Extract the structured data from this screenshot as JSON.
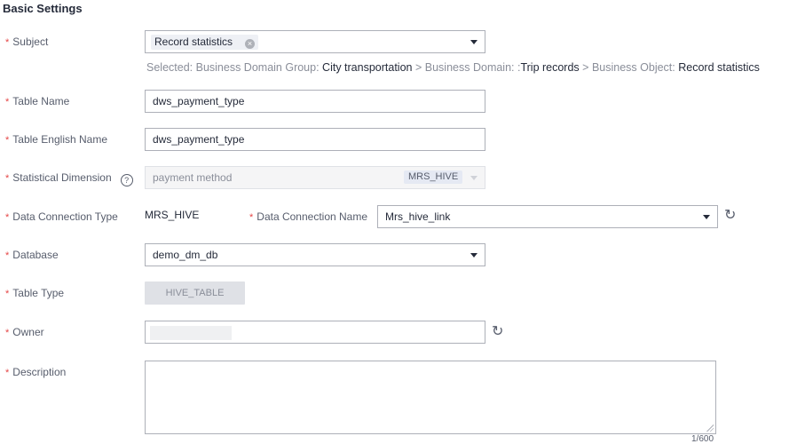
{
  "section_title": "Basic Settings",
  "required_mark": "*",
  "subject": {
    "label": "Subject",
    "tag": "Record statistics",
    "tag_remove_glyph": "×"
  },
  "selected_path": {
    "prefix": "Selected:",
    "group_label": "Business Domain Group:",
    "group_value": "City transportation",
    "separator": ">",
    "domain_label": "Business Domain: :",
    "domain_value": "Trip records",
    "object_label": "Business Object:",
    "object_value": "Record statistics"
  },
  "table_name": {
    "label": "Table Name",
    "value": "dws_payment_type"
  },
  "table_english_name": {
    "label": "Table English Name",
    "value": "dws_payment_type"
  },
  "statistical_dimension": {
    "label": "Statistical Dimension",
    "help_glyph": "?",
    "value": "payment method",
    "chip": "MRS_HIVE"
  },
  "data_connection_type": {
    "label": "Data Connection Type",
    "value": "MRS_HIVE"
  },
  "data_connection_name": {
    "label": "Data Connection Name",
    "value": "Mrs_hive_link"
  },
  "database": {
    "label": "Database",
    "value": "demo_dm_db"
  },
  "table_type": {
    "label": "Table Type",
    "value": "HIVE_TABLE"
  },
  "owner": {
    "label": "Owner",
    "value": ""
  },
  "description": {
    "label": "Description",
    "value": "",
    "counter": "1/600"
  },
  "icons": {
    "refresh": "↻",
    "dropdown": "chevron-down-icon"
  }
}
